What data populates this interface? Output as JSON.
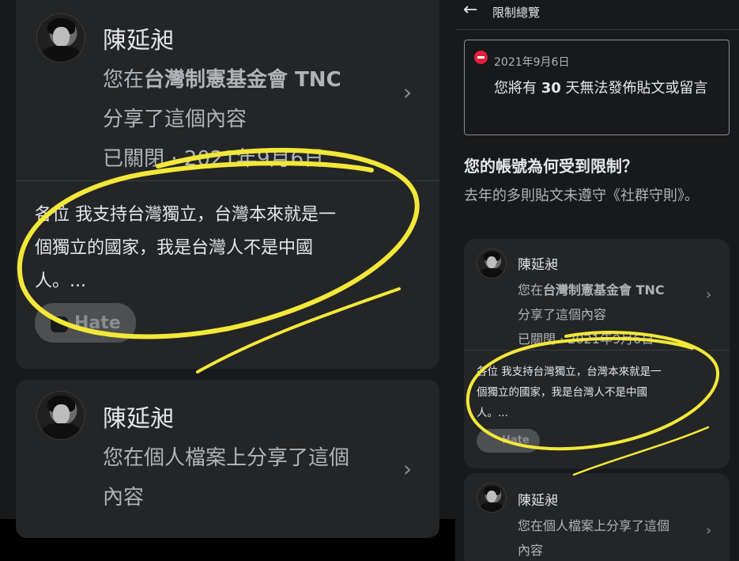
{
  "header": {
    "title": "限制總覽",
    "back_icon": "arrow-left-icon"
  },
  "notice": {
    "date": "2021年9月6日",
    "text_before": "您將有 ",
    "days": "30",
    "text_after": " 天無法發佈貼文或留言",
    "icon": "no-entry-icon",
    "icon_color": "#e41e3f"
  },
  "reason": {
    "heading": "您的帳號為何受到限制？",
    "text": "去年的多則貼文未遵守《社群守則》。"
  },
  "posts": [
    {
      "author": "陳延昶",
      "line_prefix": "您在",
      "page_name": "台灣制憲基金會 TNC",
      "line2": "分享了這個內容",
      "status": "已關閉 · 2021年9月6日",
      "body_l1": "各位 我支持台灣獨立，台灣本來就是一",
      "body_l2": "個獨立的國家，我是台灣人不是中國",
      "body_l3": "人。...",
      "tag": "Hate"
    },
    {
      "author": "陳延昶",
      "line_full": "您在個人檔案上分享了這個內容",
      "line_a": "您在個人檔案上分享了這個",
      "line_b": "內容"
    }
  ],
  "colors": {
    "background": "#18191a",
    "card": "#242526",
    "text_primary": "#e4e6eb",
    "text_secondary": "#b0b3b8",
    "highlight": "#f3e839"
  }
}
